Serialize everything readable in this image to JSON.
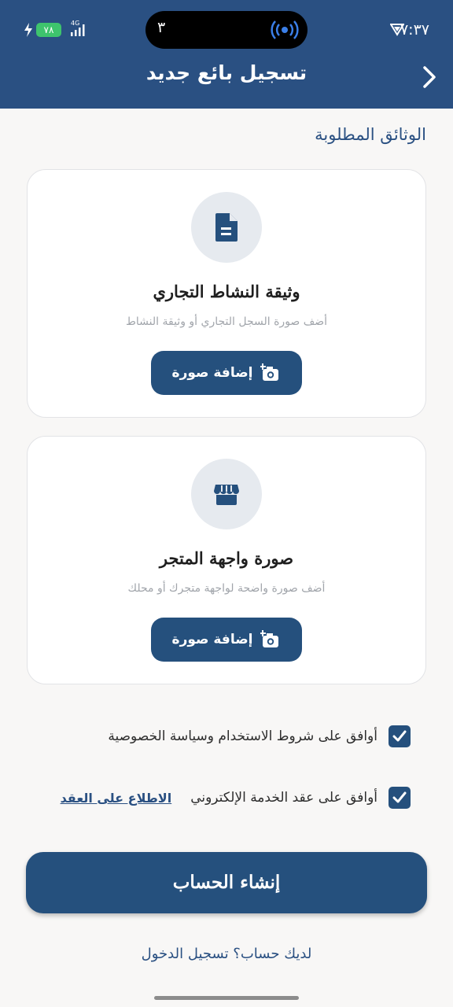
{
  "status_bar": {
    "time": "٧:٣٧",
    "battery": "٧٨",
    "network": "4G",
    "notification_count": "٣"
  },
  "header": {
    "title": "تسجيل بائع جديد"
  },
  "documents": {
    "section_title": "الوثائق المطلوبة",
    "cards": [
      {
        "icon": "document-icon",
        "title": "وثيقة النشاط التجاري",
        "description": "أضف صورة السجل التجاري أو وثيقة النشاط",
        "button_label": "إضافة صورة"
      },
      {
        "icon": "storefront-icon",
        "title": "صورة واجهة المتجر",
        "description": "أضف صورة واضحة لواجهة متجرك أو محلك",
        "button_label": "إضافة صورة"
      }
    ]
  },
  "agreements": {
    "terms_label": "أوافق على شروط الاستخدام وسياسة الخصوصية",
    "terms_checked": true,
    "contract_label": "أوافق على عقد الخدمة الإلكتروني",
    "contract_checked": true,
    "contract_link": "الاطلاع على العقد"
  },
  "actions": {
    "create_account": "إنشاء الحساب",
    "login_prompt": "لديك حساب؟ تسجيل الدخول"
  },
  "colors": {
    "primary": "#25507d",
    "header_bg": "#2a5082",
    "background": "#f8f7f6",
    "battery": "#3ec46d"
  }
}
